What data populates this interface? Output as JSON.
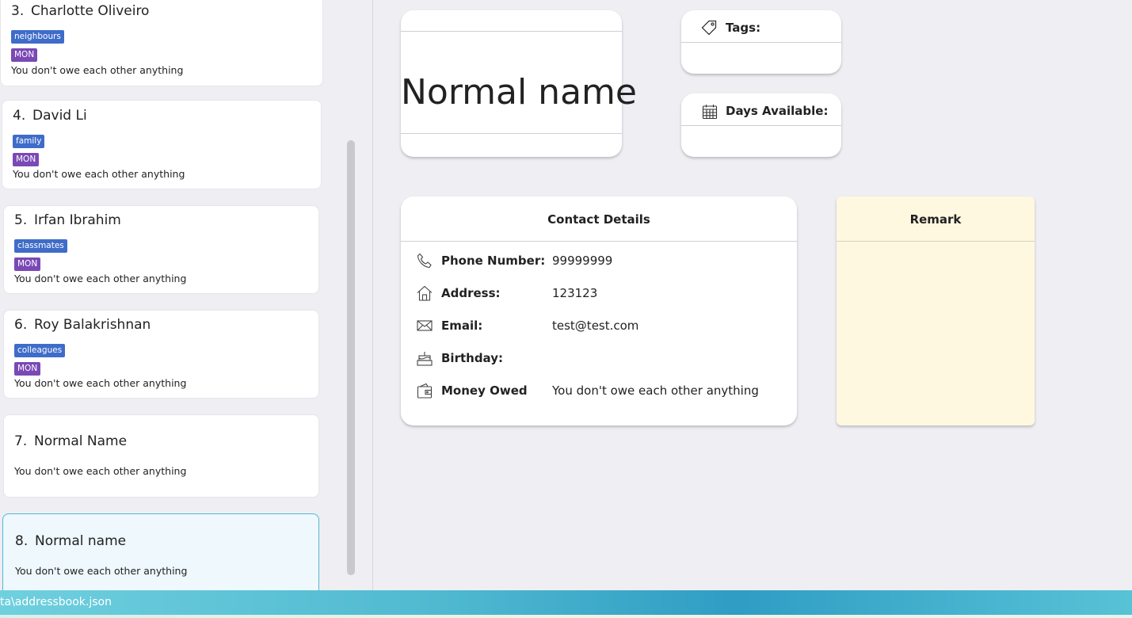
{
  "contacts": [
    {
      "index": "3.",
      "name": "Charlotte Oliveiro",
      "tag": "neighbours",
      "day": "MON",
      "owe": "You don't owe each other anything"
    },
    {
      "index": "4.",
      "name": "David Li",
      "tag": "family",
      "day": "MON",
      "owe": "You don't owe each other anything"
    },
    {
      "index": "5.",
      "name": "Irfan Ibrahim",
      "tag": "classmates",
      "day": "MON",
      "owe": "You don't owe each other anything"
    },
    {
      "index": "6.",
      "name": "Roy Balakrishnan",
      "tag": "colleagues",
      "day": "MON",
      "owe": "You don't owe each other anything"
    },
    {
      "index": "7.",
      "name": "Normal Name",
      "owe": "You don't owe each other anything"
    },
    {
      "index": "8.",
      "name": "Normal name",
      "owe": "You don't owe each other anything"
    }
  ],
  "detail": {
    "name": "Normal name",
    "tags_label": "Tags:",
    "days_label": "Days Available:",
    "contact_title": "Contact Details",
    "phone_label": "Phone Number:",
    "phone_value": "99999999",
    "address_label": "Address:",
    "address_value": "123123",
    "email_label": "Email:",
    "email_value": "test@test.com",
    "birthday_label": "Birthday:",
    "birthday_value": "",
    "money_label": "Money Owed",
    "money_value": "You don't owe each other anything",
    "remark_title": "Remark"
  },
  "status": {
    "path": "ta\\addressbook.json"
  },
  "colors": {
    "tag_blue": "#3f6cc9",
    "day_purple": "#7a49b5",
    "selected_border": "#52b8d6",
    "remark_bg": "#fff8e1"
  },
  "icons": [
    "tag-icon",
    "calendar-icon",
    "phone-icon",
    "home-icon",
    "mail-icon",
    "cake-icon",
    "wallet-icon"
  ]
}
